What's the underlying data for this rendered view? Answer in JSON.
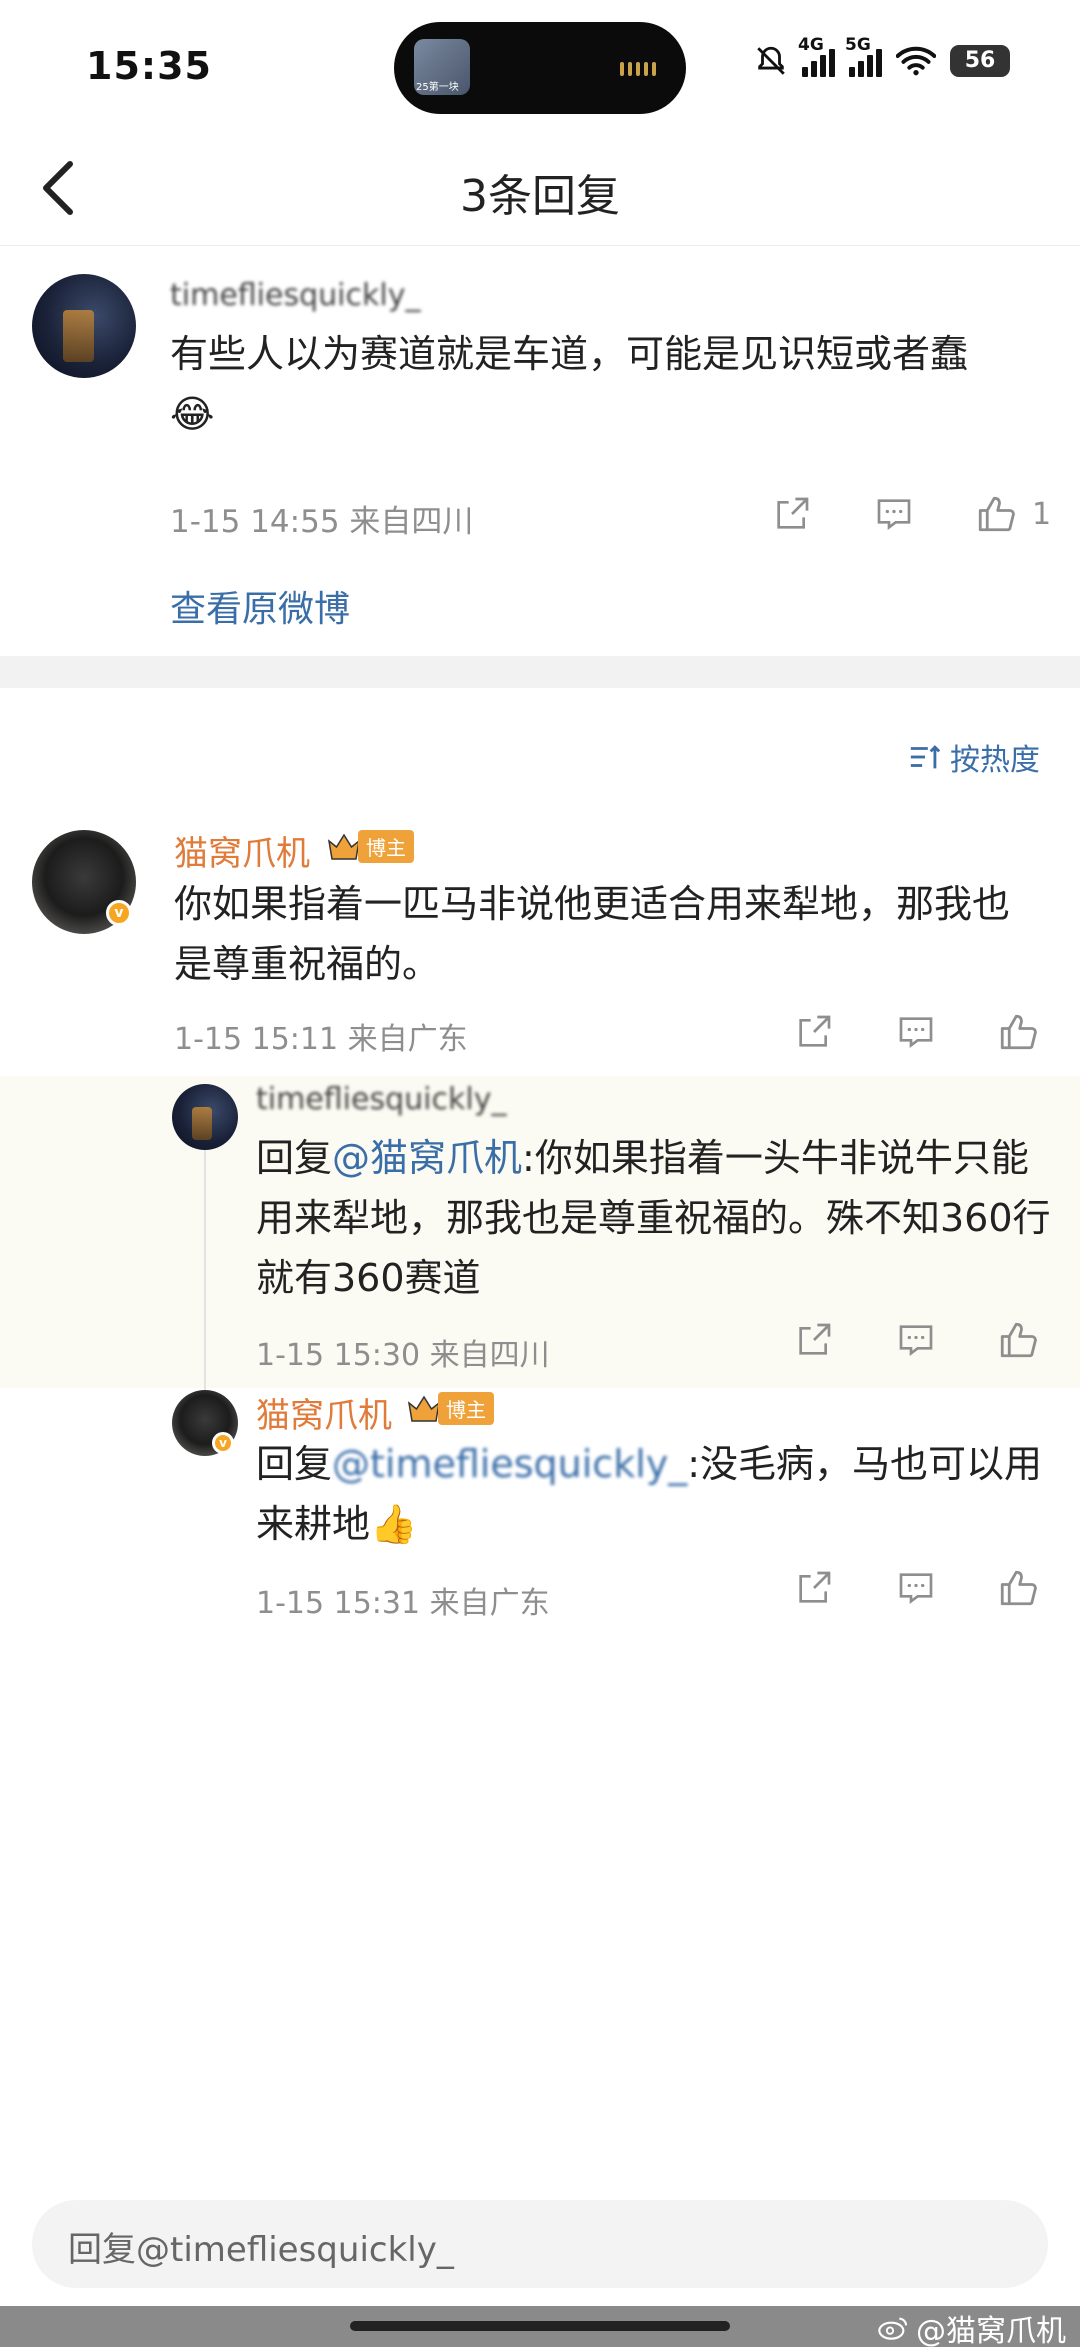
{
  "status_bar": {
    "time": "15:35",
    "island_label": "25第一块",
    "net1": "4G",
    "net2": "5G",
    "battery": "56"
  },
  "header": {
    "title": "3条回复"
  },
  "original_comment": {
    "username": "timefliesquickly_",
    "text": "有些人以为赛道就是车道，可能是见识短或者蠢",
    "emoji": "😂",
    "meta": "1-15 14:55  来自四川",
    "like_count": "1",
    "view_link": "查看原微博"
  },
  "sort": {
    "label": "按热度"
  },
  "comments": [
    {
      "username": "猫窝爪机",
      "badge": "博主",
      "text": "你如果指着一匹马非说他更适合用来犁地，那我也是尊重祝福的。",
      "meta": "1-15 15:11  来自广东"
    },
    {
      "username": "timefliesquickly_",
      "reply_prefix": "回复",
      "mention": "@猫窝爪机",
      "text": ":你如果指着一头牛非说牛只能用来犁地，那我也是尊重祝福的。殊不知360行就有360赛道",
      "meta": "1-15 15:30  来自四川"
    },
    {
      "username": "猫窝爪机",
      "badge": "博主",
      "reply_prefix": "回复",
      "mention": "@timefliesquickly_",
      "text": ":没毛病，马也可以用来耕地",
      "emoji": "👍",
      "meta": "1-15 15:31  来自广东"
    }
  ],
  "input": {
    "placeholder": "回复@timefliesquickly_"
  },
  "watermark": {
    "text": "@猫窝爪机"
  },
  "colors": {
    "link": "#3a6ea8",
    "name": "#e07b39",
    "badge": "#f0a23a"
  }
}
